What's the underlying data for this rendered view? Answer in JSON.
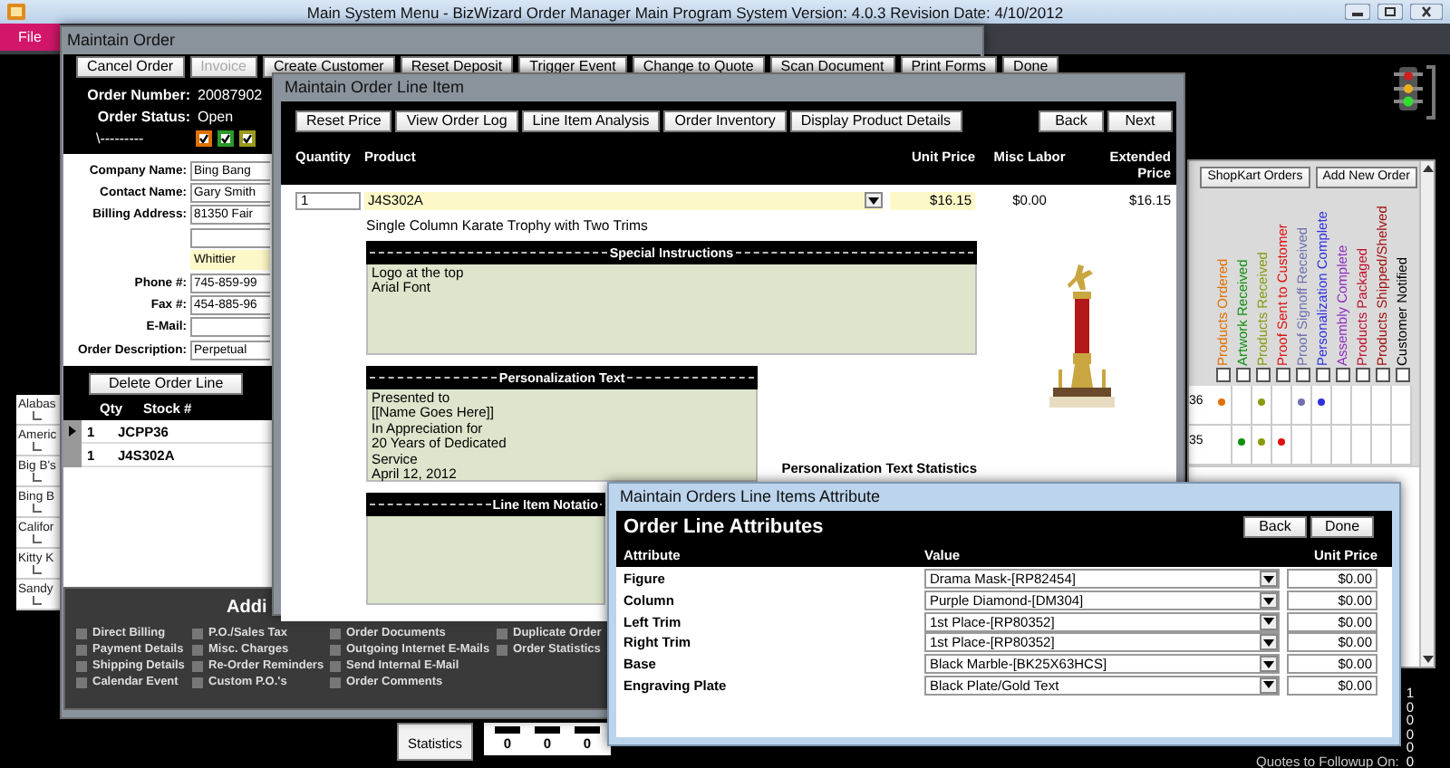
{
  "title_bar": {
    "title": "Main System Menu  -  BizWizard Order Manager Main Program System  Version: 4.0.3  Revision Date: 4/10/2012"
  },
  "main_menu": {
    "file_button": "File"
  },
  "customer_list": {
    "items": [
      "Alabas",
      "Americ",
      "Big B's",
      "Bing B",
      "Califor",
      "Kitty K",
      "Sandy"
    ]
  },
  "status_grid": {
    "buttons": [
      "ShopKart Orders",
      "Add New Order"
    ],
    "columns": [
      {
        "label": "Products Ordered",
        "color": "#e07000",
        "checked": false
      },
      {
        "label": "Artwork Received",
        "color": "#109010",
        "checked": false
      },
      {
        "label": "Products Received",
        "color": "#8a9a10",
        "checked": false
      },
      {
        "label": "Proof Sent to Customer",
        "color": "#e01010",
        "checked": false
      },
      {
        "label": "Proof Signoff Received",
        "color": "#7070b0",
        "checked": false
      },
      {
        "label": "Personalization Complete",
        "color": "#3030e0",
        "checked": false
      },
      {
        "label": "Assembly Complete",
        "color": "#9030c0",
        "checked": false
      },
      {
        "label": "Products Packaged",
        "color": "#c01030",
        "checked": false
      },
      {
        "label": "Products Shipped/Shelved",
        "color": "#a01010",
        "checked": false
      },
      {
        "label": "Customer Notified",
        "color": "#000000",
        "checked": false
      }
    ],
    "rows": [
      {
        "label": "36",
        "marks": [
          true,
          false,
          true,
          false,
          true,
          true,
          false,
          false,
          false,
          false
        ]
      },
      {
        "label": "35",
        "marks": [
          false,
          true,
          true,
          true,
          false,
          false,
          false,
          false,
          false,
          false
        ]
      }
    ]
  },
  "statistics": {
    "button": "Statistics",
    "counts": [
      "0",
      "0",
      "0"
    ],
    "values": [
      "1",
      "0",
      "0",
      "0",
      "0",
      "0"
    ],
    "quotes_label": "Quotes to Followup On:"
  },
  "maintain_order": {
    "title": "Maintain  Order",
    "toolbar": [
      {
        "label": "Cancel Order",
        "disabled": false
      },
      {
        "label": "Invoice",
        "disabled": true
      },
      {
        "label": "Create Customer",
        "disabled": false
      },
      {
        "label": "Reset Deposit",
        "disabled": false
      },
      {
        "label": "Trigger Event",
        "disabled": false
      },
      {
        "label": "Change to Quote",
        "disabled": false
      },
      {
        "label": "Scan Document",
        "disabled": false
      },
      {
        "label": "Print Forms",
        "disabled": false
      },
      {
        "label": "Done",
        "disabled": false
      }
    ],
    "order_number_label": "Order Number:",
    "order_number": "20087902",
    "order_status_label": "Order Status:",
    "order_status": "Open",
    "status_marker": "\\---------",
    "status_checks": [
      {
        "color": "#e07000",
        "checked": true
      },
      {
        "color": "#2a9a2a",
        "checked": true
      },
      {
        "color": "#9a9a20",
        "checked": true
      }
    ],
    "fields": [
      {
        "kind": "text",
        "label": "Company Name:",
        "value": "Bing Bang"
      },
      {
        "kind": "text",
        "label": "Contact Name:",
        "value": "Gary Smith"
      },
      {
        "kind": "text",
        "label": "Billing Address:",
        "value": "81350 Fair"
      },
      {
        "kind": "blank"
      },
      {
        "kind": "city",
        "value": "Whittier"
      },
      {
        "kind": "text",
        "label": "Phone #:",
        "value": "745-859-99"
      },
      {
        "kind": "text",
        "label": "Fax #:",
        "value": "454-885-96"
      },
      {
        "kind": "text",
        "label": "E-Mail:"
      },
      {
        "kind": "text",
        "label": "Order Description:",
        "value": "Perpetual"
      }
    ],
    "delete_button": "Delete Order Line",
    "lines": {
      "columns": [
        "Qty",
        "Stock #"
      ],
      "rows": [
        {
          "qty": "1",
          "stock": "JCPP36",
          "selected": true
        },
        {
          "qty": "1",
          "stock": "J4S302A",
          "selected": false
        }
      ]
    },
    "additional": {
      "title": "Addi",
      "options": [
        {
          "label": "Direct Billing",
          "checked": false
        },
        {
          "label": "Payment Details",
          "checked": false
        },
        {
          "label": "Shipping Details",
          "checked": false
        },
        {
          "label": "Calendar Event",
          "checked": false
        },
        {
          "label": "P.O./Sales Tax",
          "checked": false
        },
        {
          "label": "Misc. Charges",
          "checked": false
        },
        {
          "label": "Re-Order Reminders",
          "checked": false
        },
        {
          "label": "Custom P.O.'s",
          "checked": false
        },
        {
          "label": "Order Documents",
          "checked": false
        },
        {
          "label": "Outgoing Internet E-Mails",
          "checked": false
        },
        {
          "label": "Send Internal E-Mail",
          "checked": false
        },
        {
          "label": "Order Comments",
          "checked": false
        },
        {
          "label": "Duplicate Order",
          "checked": false
        },
        {
          "label": "Order Statistics",
          "checked": false
        }
      ]
    }
  },
  "line_item": {
    "title": "Maintain Order Line Item",
    "toolbar": [
      "Reset Price",
      "View Order Log",
      "Line Item Analysis",
      "Order Inventory",
      "Display Product Details"
    ],
    "nav": [
      "Back",
      "Next"
    ],
    "columns": [
      "Quantity",
      "Product",
      "Unit Price",
      "Misc Labor",
      "Extended Price"
    ],
    "quantity": "1",
    "product": "J4S302A",
    "unit_price": "$16.15",
    "misc_labor": "$0.00",
    "extended_price": "$16.15",
    "description": "Single Column Karate Trophy with Two Trims",
    "special_instructions": {
      "heading": "Special Instructions",
      "lines": [
        "Logo at the top",
        "Arial Font"
      ]
    },
    "personalization": {
      "heading": "Personalization Text",
      "lines": [
        "Presented to",
        "[[Name Goes Here]]",
        "In Appreciation for",
        "20 Years of Dedicated",
        "Service",
        "April 12, 2012"
      ]
    },
    "notation": {
      "heading": "Line Item Notatio"
    },
    "stats_heading": "Personalization Text Statistics"
  },
  "attributes": {
    "title": "Maintain Orders Line Items Attribute",
    "heading": "Order Line Attributes",
    "buttons": [
      "Back",
      "Done"
    ],
    "columns": [
      "Attribute",
      "Value",
      "Unit Price"
    ],
    "rows": [
      {
        "attribute": "Figure",
        "value": "Drama Mask-[RP82454]",
        "price": "$0.00"
      },
      {
        "attribute": "Column",
        "value": "Purple Diamond-[DM304]",
        "price": "$0.00"
      },
      {
        "attribute": "Left Trim",
        "value": "1st Place-[RP80352]",
        "price": "$0.00"
      },
      {
        "attribute": "Right Trim",
        "value": "1st Place-[RP80352]",
        "price": "$0.00"
      },
      {
        "attribute": "Base",
        "value": "Black Marble-[BK25X63HCS]",
        "price": "$0.00"
      },
      {
        "attribute": "Engraving Plate",
        "value": "Black Plate/Gold Text",
        "price": "$0.00"
      }
    ]
  }
}
